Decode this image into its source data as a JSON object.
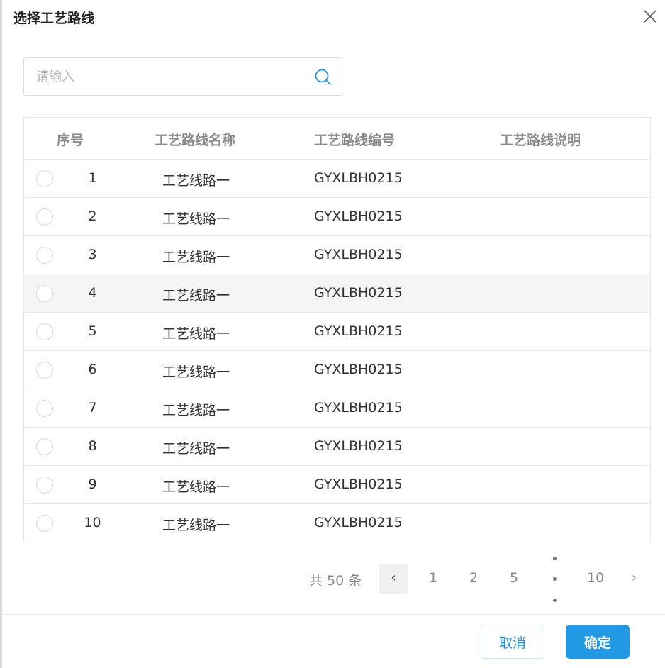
{
  "dialog": {
    "title": "选择工艺路线"
  },
  "search": {
    "placeholder": "请输入",
    "value": ""
  },
  "table": {
    "headers": {
      "index": "序号",
      "name": "工艺路线名称",
      "code": "工艺路线编号",
      "description": "工艺路线说明"
    },
    "rows": [
      {
        "index": "1",
        "name": "工艺线路一",
        "code": "GYXLBH0215",
        "description": ""
      },
      {
        "index": "2",
        "name": "工艺线路一",
        "code": "GYXLBH0215",
        "description": ""
      },
      {
        "index": "3",
        "name": "工艺线路一",
        "code": "GYXLBH0215",
        "description": ""
      },
      {
        "index": "4",
        "name": "工艺线路一",
        "code": "GYXLBH0215",
        "description": ""
      },
      {
        "index": "5",
        "name": "工艺线路一",
        "code": "GYXLBH0215",
        "description": ""
      },
      {
        "index": "6",
        "name": "工艺线路一",
        "code": "GYXLBH0215",
        "description": ""
      },
      {
        "index": "7",
        "name": "工艺线路一",
        "code": "GYXLBH0215",
        "description": ""
      },
      {
        "index": "8",
        "name": "工艺线路一",
        "code": "GYXLBH0215",
        "description": ""
      },
      {
        "index": "9",
        "name": "工艺线路一",
        "code": "GYXLBH0215",
        "description": ""
      },
      {
        "index": "10",
        "name": "工艺线路一",
        "code": "GYXLBH0215",
        "description": ""
      }
    ]
  },
  "pagination": {
    "total_label": "共 50 条",
    "prev": "‹",
    "next": "›",
    "pages": [
      "1",
      "2",
      "5",
      "10"
    ]
  },
  "footer": {
    "cancel_label": "取消",
    "confirm_label": "确定"
  },
  "icons": {
    "close": "close-icon",
    "search": "search-icon"
  },
  "colors": {
    "primary": "#2399e3",
    "hover_row": "#f5f5f5",
    "border": "#e8e8e8"
  }
}
